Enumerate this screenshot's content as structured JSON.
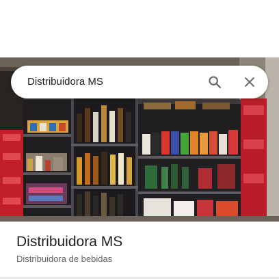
{
  "search": {
    "query": "Distribuidora MS"
  },
  "place": {
    "name": "Distribuidora MS",
    "category": "Distribuidora de bebidas"
  },
  "colors": {
    "shelf_frame": "#2b2b2e",
    "cooler_red": "#c21f2a",
    "text_primary": "#202124",
    "text_secondary": "#5f6368",
    "icon": "#5f6368"
  },
  "icons": {
    "search": "search-icon",
    "close": "close-icon"
  }
}
